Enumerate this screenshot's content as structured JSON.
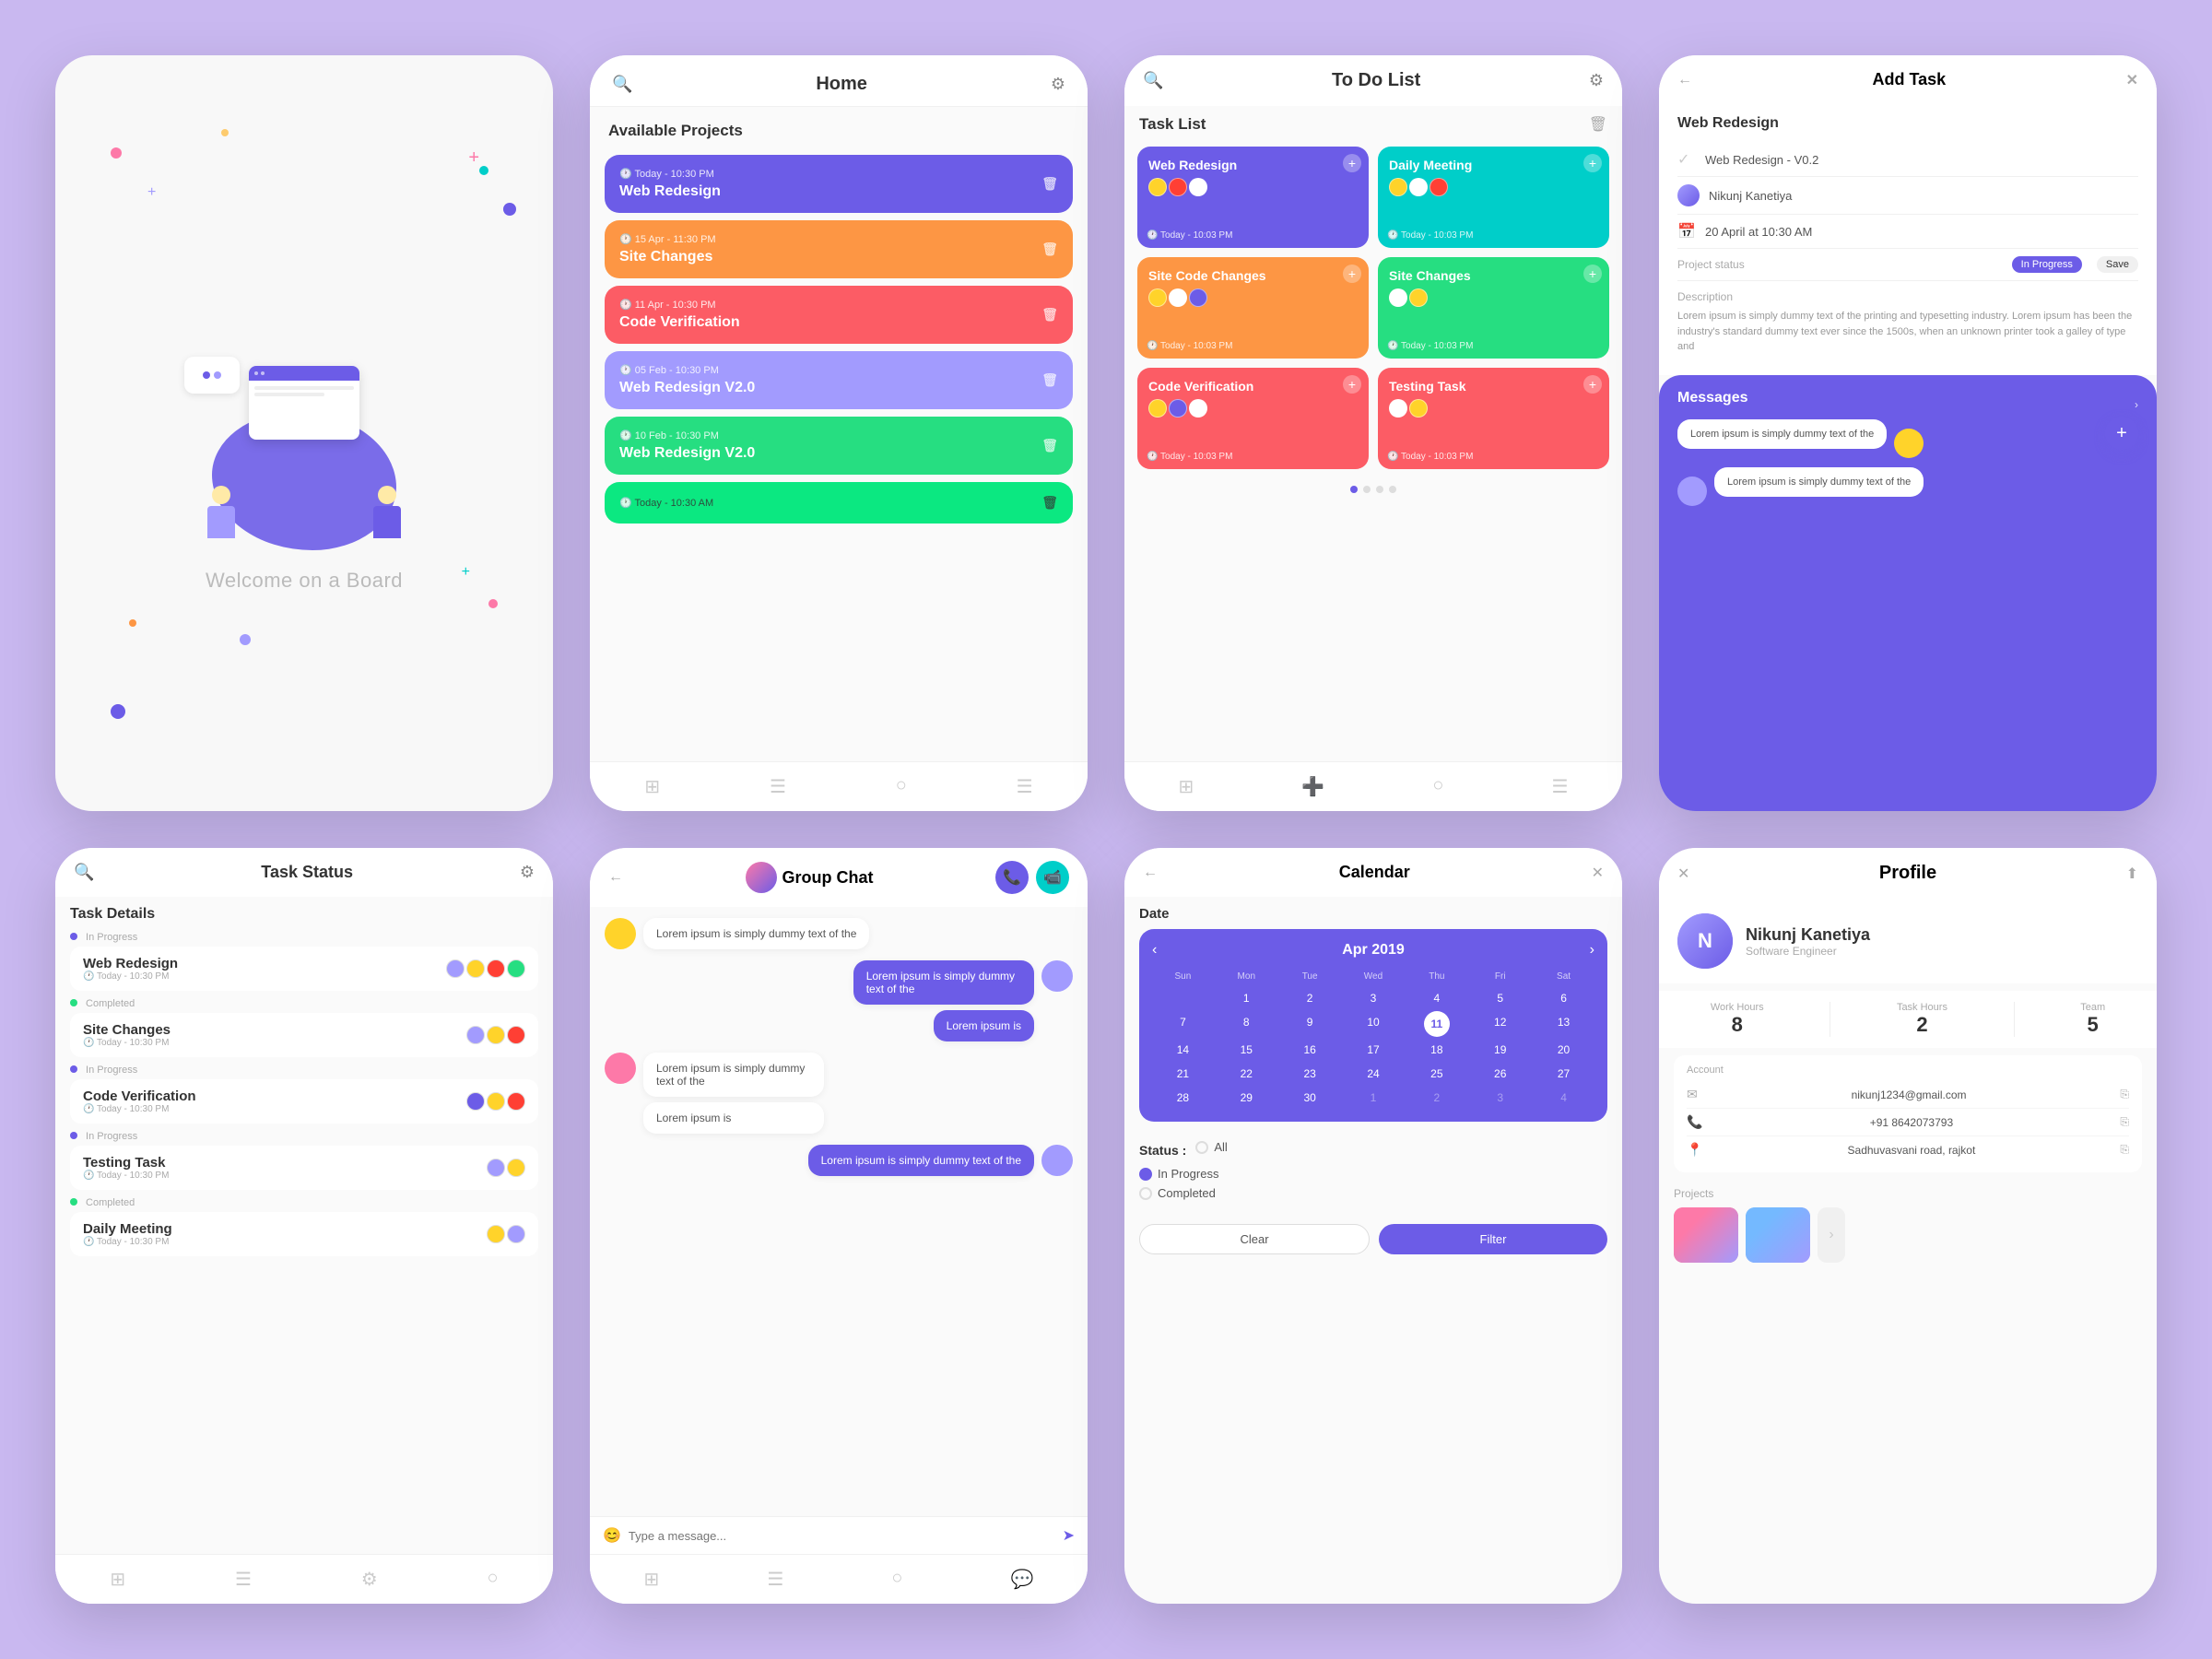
{
  "bg_color": "#c9b8f0",
  "cards": {
    "welcome": {
      "title": "Welcome on a Board"
    },
    "home": {
      "header_title": "Home",
      "section_label": "Available Projects",
      "projects": [
        {
          "title": "Web Redesign",
          "date": "Today - 10:30 PM",
          "color": "proj-blue"
        },
        {
          "title": "Site Changes",
          "date": "15 Apr - 11:30 PM",
          "color": "proj-orange"
        },
        {
          "title": "Code Verification",
          "date": "11 Apr - 10:30 PM",
          "color": "proj-red"
        },
        {
          "title": "Web Redesign V2.0",
          "date": "05 Feb - 10:30 PM",
          "color": "proj-purple"
        },
        {
          "title": "Web Redesign V2.0",
          "date": "10 Feb - 10:30 PM",
          "color": "proj-green"
        },
        {
          "title": "",
          "date": "Today - 10:30 AM",
          "color": "proj-teal"
        }
      ]
    },
    "todo": {
      "header_title": "To Do List",
      "section_label": "Task List",
      "tasks": [
        {
          "title": "Web Redesign",
          "color": "task-card-blue",
          "time": "Today - 10:03 PM"
        },
        {
          "title": "Daily Meeting",
          "color": "task-card-teal",
          "time": "Today - 10:03 PM"
        },
        {
          "title": "Site Code Changes",
          "color": "task-card-orange",
          "time": "Today - 10:03 PM"
        },
        {
          "title": "Site Changes",
          "color": "task-card-green",
          "time": "Today - 10:03 PM"
        },
        {
          "title": "Code Verification",
          "color": "task-card-coral",
          "time": "Today - 10:03 PM"
        },
        {
          "title": "Testing Task",
          "color": "task-card-red",
          "time": "Today - 10:03 PM"
        }
      ]
    },
    "addtask": {
      "header_title": "Add Task",
      "task_name": "Web Redesign",
      "subtask": "Web Redesign - V0.2",
      "assignee": "Nikunj Kanetiya",
      "date": "20 April at 10:30 AM",
      "project_status_label": "Project status",
      "status_value": "In Progress",
      "save_label": "Save",
      "description_label": "Description",
      "description_text": "Lorem ipsum is simply dummy text of the printing and typesetting industry. Lorem ipsum has been the industry's standard dummy text ever since the 1500s, when an unknown printer took a galley of type and",
      "messages_title": "Messages",
      "msg1": "Lorem ipsum is simply dummy text of the",
      "msg2": "Lorem ipsum is simply dummy text of the"
    },
    "taskstatus": {
      "header_title": "Task Status",
      "section_label": "Task Details",
      "tasks": [
        {
          "name": "Web Redesign",
          "status": "In Progress",
          "status_type": "progress",
          "time": "Today - 10:30 PM"
        },
        {
          "name": "Site Changes",
          "status": "Completed",
          "status_type": "completed",
          "time": "Today - 10:30 PM"
        },
        {
          "name": "Code Verification",
          "status": "In Progress",
          "status_type": "progress",
          "time": "Today - 10:30 PM"
        },
        {
          "name": "Testing Task",
          "status": "In Progress",
          "status_type": "progress",
          "time": "Today - 10:30 PM"
        },
        {
          "name": "Daily Meeting",
          "status": "Completed",
          "status_type": "completed",
          "time": "Today - 10:30 PM"
        }
      ]
    },
    "chat": {
      "header_title": "Group Chat",
      "messages": [
        {
          "text": "Lorem ipsum is simply dummy text of the",
          "own": false
        },
        {
          "text": "Lorem ipsum is simply dummy text of the",
          "own": true
        },
        {
          "text": "Lorem ipsum is",
          "own": true
        },
        {
          "text": "Lorem ipsum is simply dummy text of the",
          "own": false
        },
        {
          "text": "Lorem ipsum is",
          "own": false
        },
        {
          "text": "Lorem ipsum is simply dummy text of the",
          "own": true
        }
      ],
      "input_placeholder": "Type a message..."
    },
    "calendar": {
      "header_title": "Calendar",
      "date_label": "Date",
      "month": "Apr 2019",
      "days_header": [
        "Sun",
        "Mon",
        "Tue",
        "Wed",
        "Thu",
        "Fri",
        "Sat"
      ],
      "days": [
        "",
        "",
        "2",
        "3",
        "4",
        "5",
        "6",
        "7",
        "8",
        "9",
        "10",
        "11",
        "12",
        "13",
        "14",
        "15",
        "16",
        "17",
        "18",
        "19",
        "20",
        "21",
        "22",
        "23",
        "24",
        "25",
        "26",
        "27",
        "28",
        "29",
        "30",
        "1",
        "2",
        "3",
        "4"
      ],
      "today": "11",
      "status_label": "Status :",
      "status_options": [
        "All",
        "In Progress",
        "Completed"
      ],
      "selected_status": "In Progress",
      "clear_btn": "Clear",
      "filter_btn": "Filter"
    },
    "profile": {
      "header_title": "Profile",
      "user_name": "Nikunj Kanetiya",
      "user_subtitle": "Software Engineer",
      "work_hours_label": "Work Hours",
      "work_hours_value": "8",
      "task_hours_label": "Task Hours",
      "task_hours_value": "2",
      "team_label": "Team",
      "team_value": "5",
      "account_label": "Account",
      "email": "nikunj1234@gmail.com",
      "phone": "+91 8642073793",
      "address": "Sadhuvasvani road, rajkot",
      "projects_label": "Projects"
    }
  }
}
